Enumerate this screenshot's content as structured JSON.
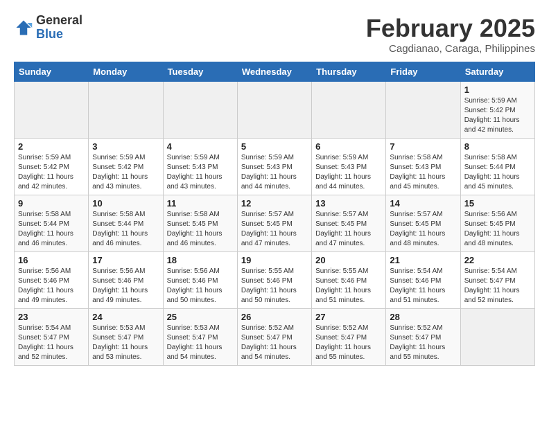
{
  "header": {
    "logo_general": "General",
    "logo_blue": "Blue",
    "month": "February 2025",
    "location": "Cagdianao, Caraga, Philippines"
  },
  "weekdays": [
    "Sunday",
    "Monday",
    "Tuesday",
    "Wednesday",
    "Thursday",
    "Friday",
    "Saturday"
  ],
  "weeks": [
    [
      {
        "day": "",
        "info": ""
      },
      {
        "day": "",
        "info": ""
      },
      {
        "day": "",
        "info": ""
      },
      {
        "day": "",
        "info": ""
      },
      {
        "day": "",
        "info": ""
      },
      {
        "day": "",
        "info": ""
      },
      {
        "day": "1",
        "info": "Sunrise: 5:59 AM\nSunset: 5:42 PM\nDaylight: 11 hours\nand 42 minutes."
      }
    ],
    [
      {
        "day": "2",
        "info": "Sunrise: 5:59 AM\nSunset: 5:42 PM\nDaylight: 11 hours\nand 42 minutes."
      },
      {
        "day": "3",
        "info": "Sunrise: 5:59 AM\nSunset: 5:42 PM\nDaylight: 11 hours\nand 43 minutes."
      },
      {
        "day": "4",
        "info": "Sunrise: 5:59 AM\nSunset: 5:43 PM\nDaylight: 11 hours\nand 43 minutes."
      },
      {
        "day": "5",
        "info": "Sunrise: 5:59 AM\nSunset: 5:43 PM\nDaylight: 11 hours\nand 44 minutes."
      },
      {
        "day": "6",
        "info": "Sunrise: 5:59 AM\nSunset: 5:43 PM\nDaylight: 11 hours\nand 44 minutes."
      },
      {
        "day": "7",
        "info": "Sunrise: 5:58 AM\nSunset: 5:43 PM\nDaylight: 11 hours\nand 45 minutes."
      },
      {
        "day": "8",
        "info": "Sunrise: 5:58 AM\nSunset: 5:44 PM\nDaylight: 11 hours\nand 45 minutes."
      }
    ],
    [
      {
        "day": "9",
        "info": "Sunrise: 5:58 AM\nSunset: 5:44 PM\nDaylight: 11 hours\nand 46 minutes."
      },
      {
        "day": "10",
        "info": "Sunrise: 5:58 AM\nSunset: 5:44 PM\nDaylight: 11 hours\nand 46 minutes."
      },
      {
        "day": "11",
        "info": "Sunrise: 5:58 AM\nSunset: 5:45 PM\nDaylight: 11 hours\nand 46 minutes."
      },
      {
        "day": "12",
        "info": "Sunrise: 5:57 AM\nSunset: 5:45 PM\nDaylight: 11 hours\nand 47 minutes."
      },
      {
        "day": "13",
        "info": "Sunrise: 5:57 AM\nSunset: 5:45 PM\nDaylight: 11 hours\nand 47 minutes."
      },
      {
        "day": "14",
        "info": "Sunrise: 5:57 AM\nSunset: 5:45 PM\nDaylight: 11 hours\nand 48 minutes."
      },
      {
        "day": "15",
        "info": "Sunrise: 5:56 AM\nSunset: 5:45 PM\nDaylight: 11 hours\nand 48 minutes."
      }
    ],
    [
      {
        "day": "16",
        "info": "Sunrise: 5:56 AM\nSunset: 5:46 PM\nDaylight: 11 hours\nand 49 minutes."
      },
      {
        "day": "17",
        "info": "Sunrise: 5:56 AM\nSunset: 5:46 PM\nDaylight: 11 hours\nand 49 minutes."
      },
      {
        "day": "18",
        "info": "Sunrise: 5:56 AM\nSunset: 5:46 PM\nDaylight: 11 hours\nand 50 minutes."
      },
      {
        "day": "19",
        "info": "Sunrise: 5:55 AM\nSunset: 5:46 PM\nDaylight: 11 hours\nand 50 minutes."
      },
      {
        "day": "20",
        "info": "Sunrise: 5:55 AM\nSunset: 5:46 PM\nDaylight: 11 hours\nand 51 minutes."
      },
      {
        "day": "21",
        "info": "Sunrise: 5:54 AM\nSunset: 5:46 PM\nDaylight: 11 hours\nand 51 minutes."
      },
      {
        "day": "22",
        "info": "Sunrise: 5:54 AM\nSunset: 5:47 PM\nDaylight: 11 hours\nand 52 minutes."
      }
    ],
    [
      {
        "day": "23",
        "info": "Sunrise: 5:54 AM\nSunset: 5:47 PM\nDaylight: 11 hours\nand 52 minutes."
      },
      {
        "day": "24",
        "info": "Sunrise: 5:53 AM\nSunset: 5:47 PM\nDaylight: 11 hours\nand 53 minutes."
      },
      {
        "day": "25",
        "info": "Sunrise: 5:53 AM\nSunset: 5:47 PM\nDaylight: 11 hours\nand 54 minutes."
      },
      {
        "day": "26",
        "info": "Sunrise: 5:52 AM\nSunset: 5:47 PM\nDaylight: 11 hours\nand 54 minutes."
      },
      {
        "day": "27",
        "info": "Sunrise: 5:52 AM\nSunset: 5:47 PM\nDaylight: 11 hours\nand 55 minutes."
      },
      {
        "day": "28",
        "info": "Sunrise: 5:52 AM\nSunset: 5:47 PM\nDaylight: 11 hours\nand 55 minutes."
      },
      {
        "day": "",
        "info": ""
      }
    ]
  ]
}
